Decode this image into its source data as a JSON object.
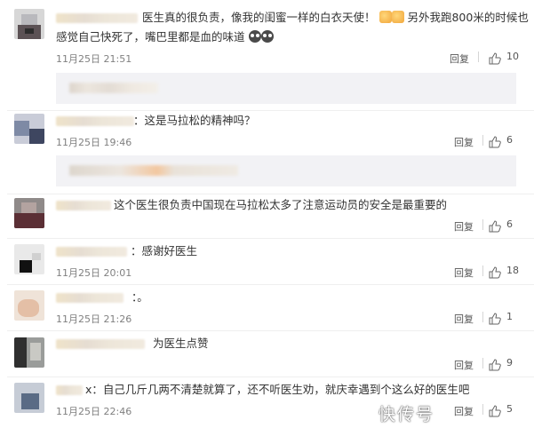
{
  "comments": [
    {
      "line1": "医生真的很负责，像我的闺蜜一样的白衣天使！",
      "line1_tail": "另外我跑800米的时候也",
      "line2": "感觉自己快死了，嘴巴里都是血的味道",
      "time": "11月25日 21:51",
      "reply": "回复",
      "likes": "10"
    },
    {
      "line1": "：这是马拉松的精神吗？",
      "time": "11月25日 19:46",
      "reply": "回复",
      "likes": "6"
    },
    {
      "line1": "这个医生很负责中国现在马拉松太多了注意运动员的安全是最重要的",
      "reply": "回复",
      "likes": "6"
    },
    {
      "line1": "：感谢好医生",
      "time": "11月25日 20:01",
      "reply": "回复",
      "likes": "18"
    },
    {
      "line1": "：。",
      "time": "11月25日 21:26",
      "reply": "回复",
      "likes": "1"
    },
    {
      "line1": "为医生点赞",
      "reply": "回复",
      "likes": "9"
    },
    {
      "line1": "x：自己几斤几两不清楚就算了，还不听医生劝，就庆幸遇到个这么好的医生吧",
      "time": "11月25日 22:46",
      "reply": "回复",
      "likes": "5"
    }
  ],
  "icons": {
    "like": "thumbs-up-outline-icon",
    "emoji_thumbs": "thumbs-up-emoji-icon",
    "emoji_sad": "crying-face-emoji-icon"
  },
  "colors": {
    "text": "#333333",
    "time": "#808080",
    "reply_box": "#f2f2f5"
  },
  "watermark": "快传号"
}
